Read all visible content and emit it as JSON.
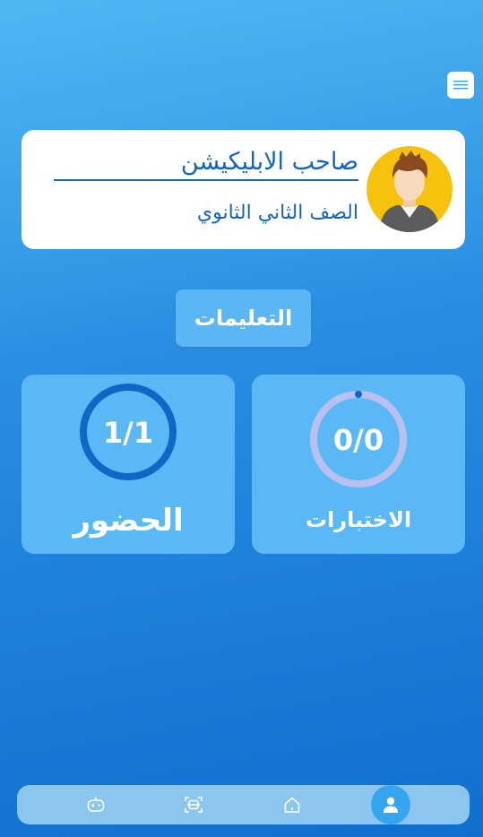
{
  "profile": {
    "name": "صاحب الابليكيشن",
    "grade": "الصف الثاني الثانوي"
  },
  "instructions_label": "التعليمات",
  "stats": {
    "attendance": {
      "value": "1/1",
      "label": "الحضور",
      "progress": 1.0
    },
    "exams": {
      "value": "0/0",
      "label": "الاختبارات",
      "progress": 0.0
    }
  },
  "colors": {
    "accent": "#1566b8",
    "card": "#5ab9f5",
    "ring_full": "#1266c4",
    "ring_empty": "#b9bfee"
  },
  "nav": {
    "items": [
      {
        "icon": "gamepad-icon",
        "active": false
      },
      {
        "icon": "scan-icon",
        "active": false
      },
      {
        "icon": "home-icon",
        "active": false
      },
      {
        "icon": "profile-icon",
        "active": true
      }
    ]
  }
}
